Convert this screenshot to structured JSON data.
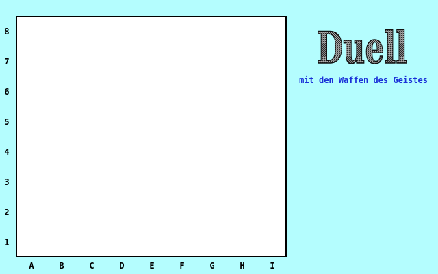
{
  "board": {
    "rank_labels": [
      "8",
      "7",
      "6",
      "5",
      "4",
      "3",
      "2",
      "1"
    ],
    "file_labels": [
      "A",
      "B",
      "C",
      "D",
      "E",
      "F",
      "G",
      "H",
      "I"
    ]
  },
  "logo": {
    "text": "Duell"
  },
  "subtitle": "mit den Waffen des Geistes",
  "colors": {
    "background": "#b4fdfe",
    "board": "#ffffff",
    "subtitle": "#1a30d8",
    "logo_fill": "#8a8a8a"
  }
}
